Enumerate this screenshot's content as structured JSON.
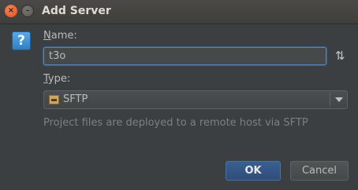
{
  "window": {
    "title": "Add Server",
    "close_glyph": "×",
    "minimize_glyph": "–"
  },
  "form": {
    "name_label_first": "N",
    "name_label_rest": "ame:",
    "name_value": "t3o",
    "type_label_first": "T",
    "type_label_rest": "ype:",
    "type_value": "SFTP",
    "hint": "Project files are deployed to a remote host via SFTP"
  },
  "buttons": {
    "ok": "OK",
    "cancel": "Cancel"
  },
  "icons": {
    "question": "?",
    "sort": "⇅"
  },
  "colors": {
    "background": "#3c3f41",
    "focus_border": "#4a88c7",
    "ok_button": "#2e4e7a"
  }
}
